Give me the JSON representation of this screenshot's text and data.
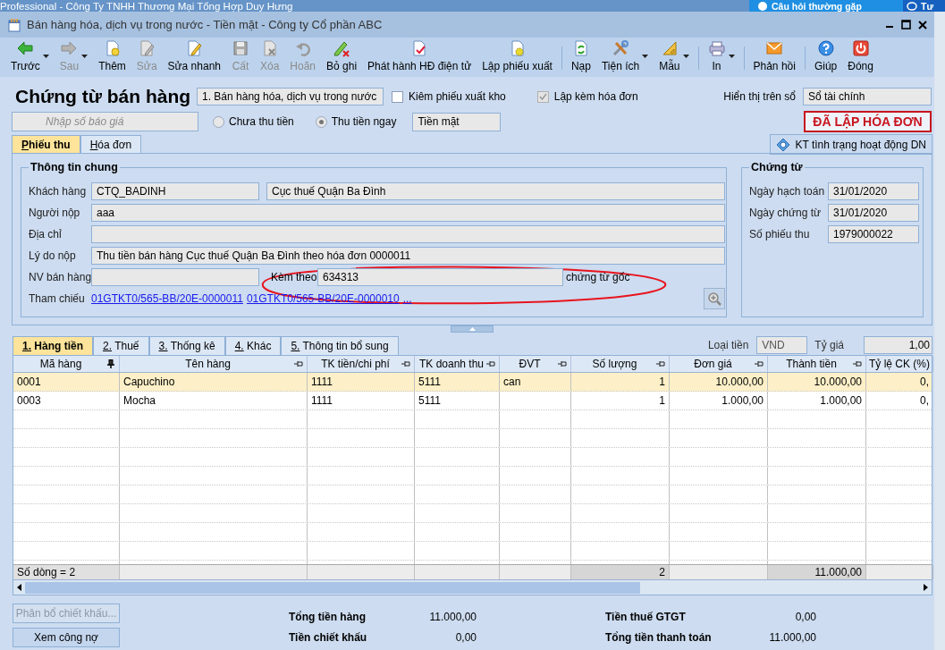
{
  "app_title": "Professional - Công Ty TNHH Thương Mại Tổng Hợp Duy Hưng",
  "help_button": {
    "label": "Câu hỏi thường gặp"
  },
  "support_button": {
    "label": "Tư"
  },
  "window": {
    "title": "Bán hàng hóa, dịch vụ trong nước - Tiền mặt - Công ty Cổ phần ABC"
  },
  "toolbar": [
    {
      "kind": "button",
      "label": "Trước",
      "disabled": false,
      "dropdown": true
    },
    {
      "kind": "button",
      "label": "Sau",
      "disabled": true,
      "dropdown": true
    },
    {
      "kind": "button",
      "label": "Thêm",
      "disabled": false,
      "dropdown": false
    },
    {
      "kind": "button",
      "label": "Sửa",
      "disabled": true,
      "dropdown": false
    },
    {
      "kind": "button",
      "label": "Sửa nhanh",
      "disabled": false,
      "dropdown": false
    },
    {
      "kind": "button",
      "label": "Cất",
      "disabled": true,
      "dropdown": false
    },
    {
      "kind": "button",
      "label": "Xóa",
      "disabled": true,
      "dropdown": false
    },
    {
      "kind": "button",
      "label": "Hoãn",
      "disabled": true,
      "dropdown": false
    },
    {
      "kind": "button",
      "label": "Bỏ ghi",
      "disabled": false,
      "dropdown": false
    },
    {
      "kind": "button",
      "label": "Phát hành HĐ điện tử",
      "disabled": false,
      "dropdown": false
    },
    {
      "kind": "button",
      "label": "Lập phiếu xuất",
      "disabled": false,
      "dropdown": false
    },
    {
      "kind": "separator"
    },
    {
      "kind": "button",
      "label": "Nạp",
      "disabled": false,
      "dropdown": false
    },
    {
      "kind": "button",
      "label": "Tiện ích",
      "disabled": false,
      "dropdown": true
    },
    {
      "kind": "button",
      "label": "Mẫu",
      "disabled": false,
      "dropdown": true
    },
    {
      "kind": "separator"
    },
    {
      "kind": "button",
      "label": "In",
      "disabled": false,
      "dropdown": true
    },
    {
      "kind": "separator"
    },
    {
      "kind": "button",
      "label": "Phản hồi",
      "disabled": false,
      "dropdown": false
    },
    {
      "kind": "separator"
    },
    {
      "kind": "button",
      "label": "Giúp",
      "disabled": false,
      "dropdown": false
    },
    {
      "kind": "button",
      "label": "Đóng",
      "disabled": false,
      "dropdown": false
    }
  ],
  "header": {
    "title": "Chứng từ bán hàng",
    "transaction_type": "1. Bán hàng hóa, dịch vụ trong nước",
    "options": [
      {
        "label": "Kiêm phiếu xuất kho",
        "checked": false,
        "disabled": false
      },
      {
        "label": "Lập kèm hóa đơn",
        "checked": true,
        "disabled": true
      }
    ],
    "ledger_label": "Hiển thị trên sổ",
    "ledger_value": "Sổ tài chính",
    "quote_field": {
      "placeholder": "Nhập số báo giá"
    },
    "payment": [
      {
        "label": "Chưa thu tiền",
        "selected": false
      },
      {
        "label": "Thu tiền ngay",
        "selected": true
      }
    ],
    "payment_method": "Tiền mặt",
    "status_stamp": "ĐÃ LẬP HÓA ĐƠN"
  },
  "tabs": [
    {
      "label": "Phiếu thu",
      "selected": true
    },
    {
      "label": "Hóa đơn",
      "selected": false
    }
  ],
  "check_status_button": "KT tình trạng hoạt động DN",
  "general_info": {
    "title": "Thông tin chung",
    "customer_label": "Khách hàng",
    "customer_code": "CTQ_BADINH",
    "customer_name": "Cục thuế Quận Ba Đình",
    "payer_label": "Người nộp",
    "payer": "aaa",
    "address_label": "Địa chỉ",
    "reason_label": "Lý do nộp",
    "reason": "Thu tiền bán hàng Cục thuế Quận Ba Đình theo hóa đơn 0000011",
    "salesperson_label": "NV bán hàng",
    "attached_label": "Kèm theo",
    "attached": "634313",
    "attached_suffix": "chứng từ gốc",
    "reference_label": "Tham chiếu",
    "references": [
      "01GTKT0/565-BB/20E-0000011",
      "01GTKT0/565-BB/20E-0000010",
      "..."
    ]
  },
  "voucher": {
    "title": "Chứng từ",
    "fields": [
      {
        "label": "Ngày hạch toán",
        "value": "31/01/2020"
      },
      {
        "label": "Ngày chứng từ",
        "value": "31/01/2020"
      },
      {
        "label": "Số phiếu thu",
        "value": "1979000022"
      }
    ]
  },
  "detail_tabs": [
    {
      "label": "1. Hàng tiền",
      "selected": true
    },
    {
      "label": "2. Thuế",
      "selected": false
    },
    {
      "label": "3. Thống kê",
      "selected": false
    },
    {
      "label": "4. Khác",
      "selected": false
    },
    {
      "label": "5. Thông tin bổ sung",
      "selected": false
    }
  ],
  "currency_label": "Loại tiền",
  "currency": "VND",
  "rate_label": "Tỷ giá",
  "rate": "1,00",
  "table": {
    "columns": [
      {
        "label": "Mã hàng",
        "pinned": true
      },
      {
        "label": "Tên hàng",
        "pinned": false
      },
      {
        "label": "TK tiền/chi phí",
        "pinned": false
      },
      {
        "label": "TK doanh thu",
        "pinned": false
      },
      {
        "label": "ĐVT",
        "pinned": false
      },
      {
        "label": "Số lượng",
        "pinned": false
      },
      {
        "label": "Đơn giá",
        "pinned": false
      },
      {
        "label": "Thành tiền",
        "pinned": false
      },
      {
        "label": "Tỷ lệ CK (%)"
      }
    ],
    "rows": [
      {
        "selected": true,
        "cells": [
          "0001",
          "Capuchino",
          "1111",
          "5111",
          "can",
          "1",
          "10.000,00",
          "10.000,00",
          "0,"
        ]
      },
      {
        "selected": false,
        "cells": [
          "0003",
          "Mocha",
          "1111",
          "5111",
          "",
          "1",
          "1.000,00",
          "1.000,00",
          "0,"
        ]
      }
    ],
    "footer": {
      "row_count": "Số dòng = 2",
      "quantity_total": "2",
      "amount_total": "11.000,00"
    }
  },
  "buttons": [
    {
      "label": "Phân bổ chiết khấu...",
      "disabled": true
    },
    {
      "label": "Xem công nợ",
      "disabled": false
    }
  ],
  "totals": [
    {
      "label": "Tổng tiền hàng",
      "value": "11.000,00"
    },
    {
      "label": "Tiền chiết khấu",
      "value": "0,00"
    },
    {
      "label": "Tiền thuế GTGT",
      "value": "0,00"
    },
    {
      "label": "Tổng tiền thanh toán",
      "value": "11.000,00"
    }
  ]
}
